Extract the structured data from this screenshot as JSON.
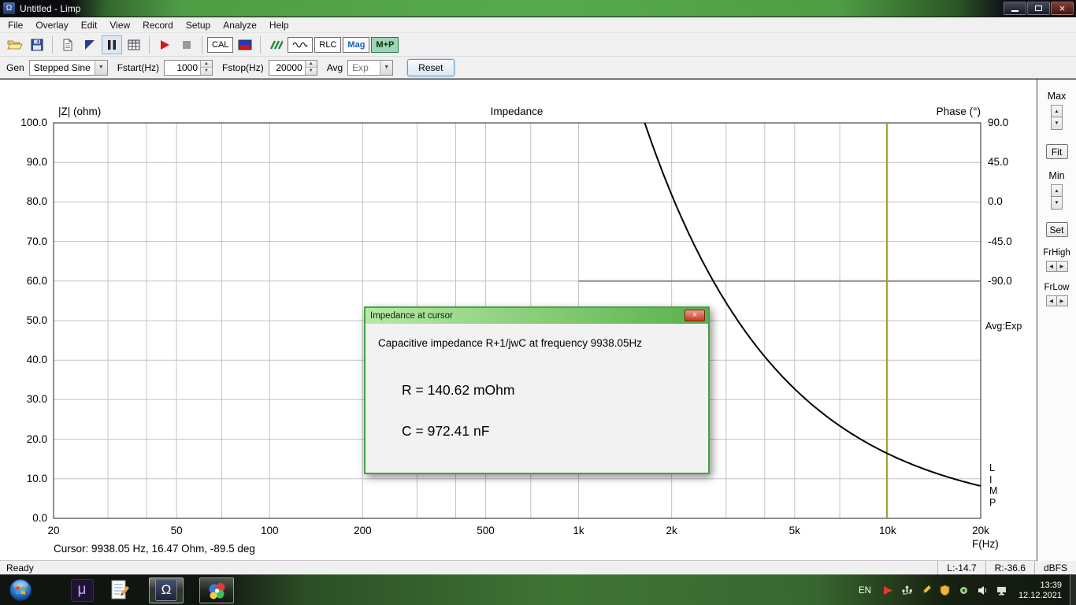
{
  "window": {
    "title": "Untitled - Limp"
  },
  "menu": {
    "items": [
      "File",
      "Overlay",
      "Edit",
      "View",
      "Record",
      "Setup",
      "Analyze",
      "Help"
    ]
  },
  "toolbar": {
    "cal_label": "CAL",
    "rlc_label": "RLC",
    "mag_label": "Mag",
    "mp_label": "M+P",
    "icon_names": [
      "open-icon",
      "save-icon",
      "copy-icon",
      "overlay-icon",
      "pause-icon",
      "table-icon",
      "record-icon",
      "stop-icon",
      "gen-setup-icon",
      "stripes-icon",
      "sine-icon"
    ]
  },
  "controls_bar": {
    "gen_label": "Gen",
    "gen_value": "Stepped Sine",
    "fstart_label": "Fstart(Hz)",
    "fstart_value": "1000",
    "fstop_label": "Fstop(Hz)",
    "fstop_value": "20000",
    "avg_label": "Avg",
    "avg_value": "Exp",
    "reset_label": "Reset"
  },
  "chart": {
    "title": "Impedance",
    "left_axis_label": "|Z| (ohm)",
    "right_axis_label": "Phase (°)",
    "x_axis_label": "F(Hz)",
    "left_ticks": [
      "100.0",
      "90.0",
      "80.0",
      "70.0",
      "60.0",
      "50.0",
      "40.0",
      "30.0",
      "20.0",
      "10.0",
      "0.0"
    ],
    "right_ticks": [
      "90.0",
      "45.0",
      "0.0",
      "-45.0",
      "-90.0"
    ],
    "x_ticks": [
      "20",
      "50",
      "100",
      "200",
      "500",
      "1k",
      "2k",
      "5k",
      "10k",
      "20k"
    ],
    "cursor_readout": "Cursor: 9938.05 Hz, 16.47 Ohm, -89.5 deg"
  },
  "chart_data": {
    "type": "line",
    "title": "Impedance",
    "x_scale": "log",
    "x_range": [
      20,
      20000
    ],
    "y_range": [
      0,
      100
    ],
    "phase_range": [
      -90,
      90
    ],
    "phase_deg_per_division": 45,
    "x_gridlines": [
      20,
      30,
      40,
      50,
      70,
      100,
      200,
      300,
      400,
      500,
      700,
      1000,
      2000,
      3000,
      4000,
      5000,
      7000,
      10000,
      20000
    ],
    "x_tick_values": [
      20,
      50,
      100,
      200,
      500,
      1000,
      2000,
      5000,
      10000,
      20000
    ],
    "y_gridlines": [
      0,
      10,
      20,
      30,
      40,
      50,
      60,
      70,
      80,
      90,
      100
    ],
    "phase_tick_values": [
      90,
      45,
      0,
      -45,
      -90
    ],
    "series": [
      {
        "name": "impedance-magnitude",
        "model": "R + 1/(jwC)",
        "R_ohm": 0.14062,
        "C_farad": 9.7241e-07,
        "f_start": 1000,
        "f_stop": 20000,
        "color": "#000000"
      },
      {
        "name": "phase",
        "constant_deg": -90,
        "f_start": 1000,
        "f_stop": 20000,
        "color": "#8c8c8c"
      }
    ],
    "cursor": {
      "frequency_hz": 9938.05,
      "impedance_ohm": 16.47,
      "phase_deg": -89.5,
      "color": "#a2a22e"
    }
  },
  "dialog": {
    "title": "Impedance at cursor",
    "line1": "Capacitive impedance R+1/jwC at frequency 9938.05Hz",
    "r_line": "R = 140.62 mOhm",
    "c_line": "C = 972.41 nF"
  },
  "right_panel": {
    "max_label": "Max",
    "fit_label": "Fit",
    "min_label": "Min",
    "set_label": "Set",
    "frhigh_label": "FrHigh",
    "frlow_label": "FrLow",
    "avg_text": "Avg:Exp",
    "limp_letters": [
      "L",
      "I",
      "M",
      "P"
    ]
  },
  "status_bar": {
    "ready": "Ready",
    "left_level": "L:-14.7",
    "right_level": "R:-36.6",
    "units": "dBFS"
  },
  "taskbar": {
    "tray_lang": "EN",
    "time": "13:39",
    "date": "12.12.2021",
    "app_icon_names": [
      "start-orb-icon",
      "arta-mu-icon",
      "notepad-icon",
      "limp-omega-icon",
      "paint-palette-icon"
    ],
    "tray_icon_names": [
      "tray-red-player-icon",
      "tray-usb-icon",
      "tray-pencil-icon",
      "tray-shield-icon",
      "tray-gear-icon",
      "tray-speaker-icon",
      "tray-monitor-icon"
    ]
  }
}
